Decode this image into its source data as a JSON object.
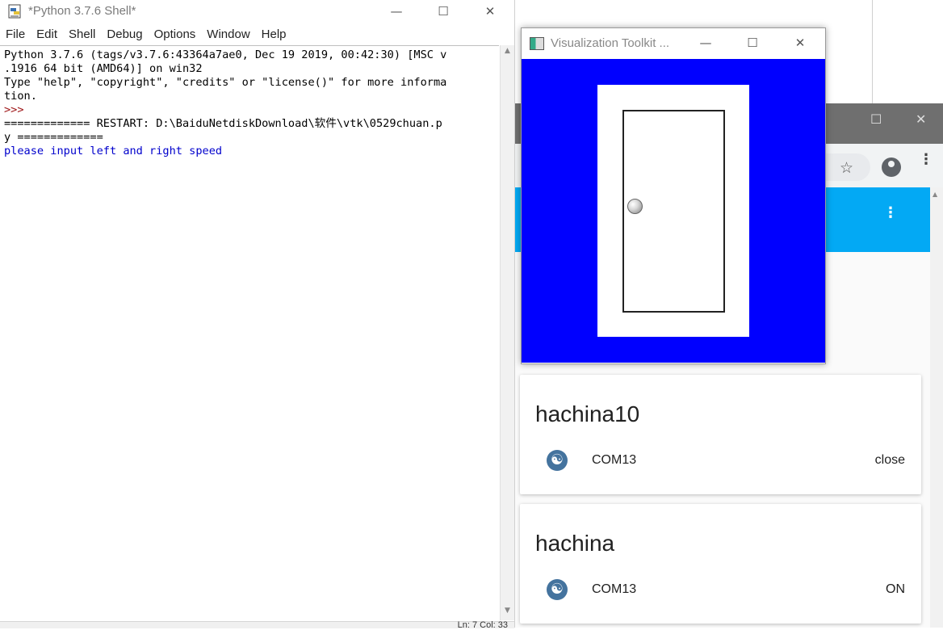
{
  "shell": {
    "title": "*Python 3.7.6 Shell*",
    "window_controls": {
      "minimize": "—",
      "maximize": "☐",
      "close": "✕"
    },
    "menu": [
      "File",
      "Edit",
      "Shell",
      "Debug",
      "Options",
      "Window",
      "Help"
    ],
    "output": {
      "line1": "Python 3.7.6 (tags/v3.7.6:43364a7ae0, Dec 19 2019, 00:42:30) [MSC v",
      "line2": ".1916 64 bit (AMD64)] on win32",
      "line3": "Type \"help\", \"copyright\", \"credits\" or \"license()\" for more informa",
      "line4": "tion.",
      "prompt": ">>> ",
      "line5": "============= RESTART: D:\\BaiduNetdiskDownload\\软件\\vtk\\0529chuan.p",
      "line6": "y =============",
      "line7": "please input left and right speed"
    },
    "scroll_up": "▲",
    "scroll_down": "▼",
    "status": "Ln: 7  Col: 33"
  },
  "vtk": {
    "title": "Visualization Toolkit ...",
    "window_controls": {
      "minimize": "—",
      "maximize": "☐",
      "close": "✕"
    },
    "colors": {
      "background": "#0000ff",
      "panel": "#ffffff",
      "door_outline": "#222222"
    }
  },
  "browser": {
    "window_controls": {
      "maximize": "☐",
      "close": "✕"
    },
    "star_icon": "☆",
    "menu_icon": "⋮",
    "appbar_menu_icon": "⋮",
    "accent_color": "#03a9f4",
    "cards": [
      {
        "title": "hachina10",
        "icon": "yin-yang-icon",
        "port": "COM13",
        "state": "close"
      },
      {
        "title": "hachina",
        "icon": "yin-yang-icon",
        "port": "COM13",
        "state": "ON"
      }
    ]
  }
}
